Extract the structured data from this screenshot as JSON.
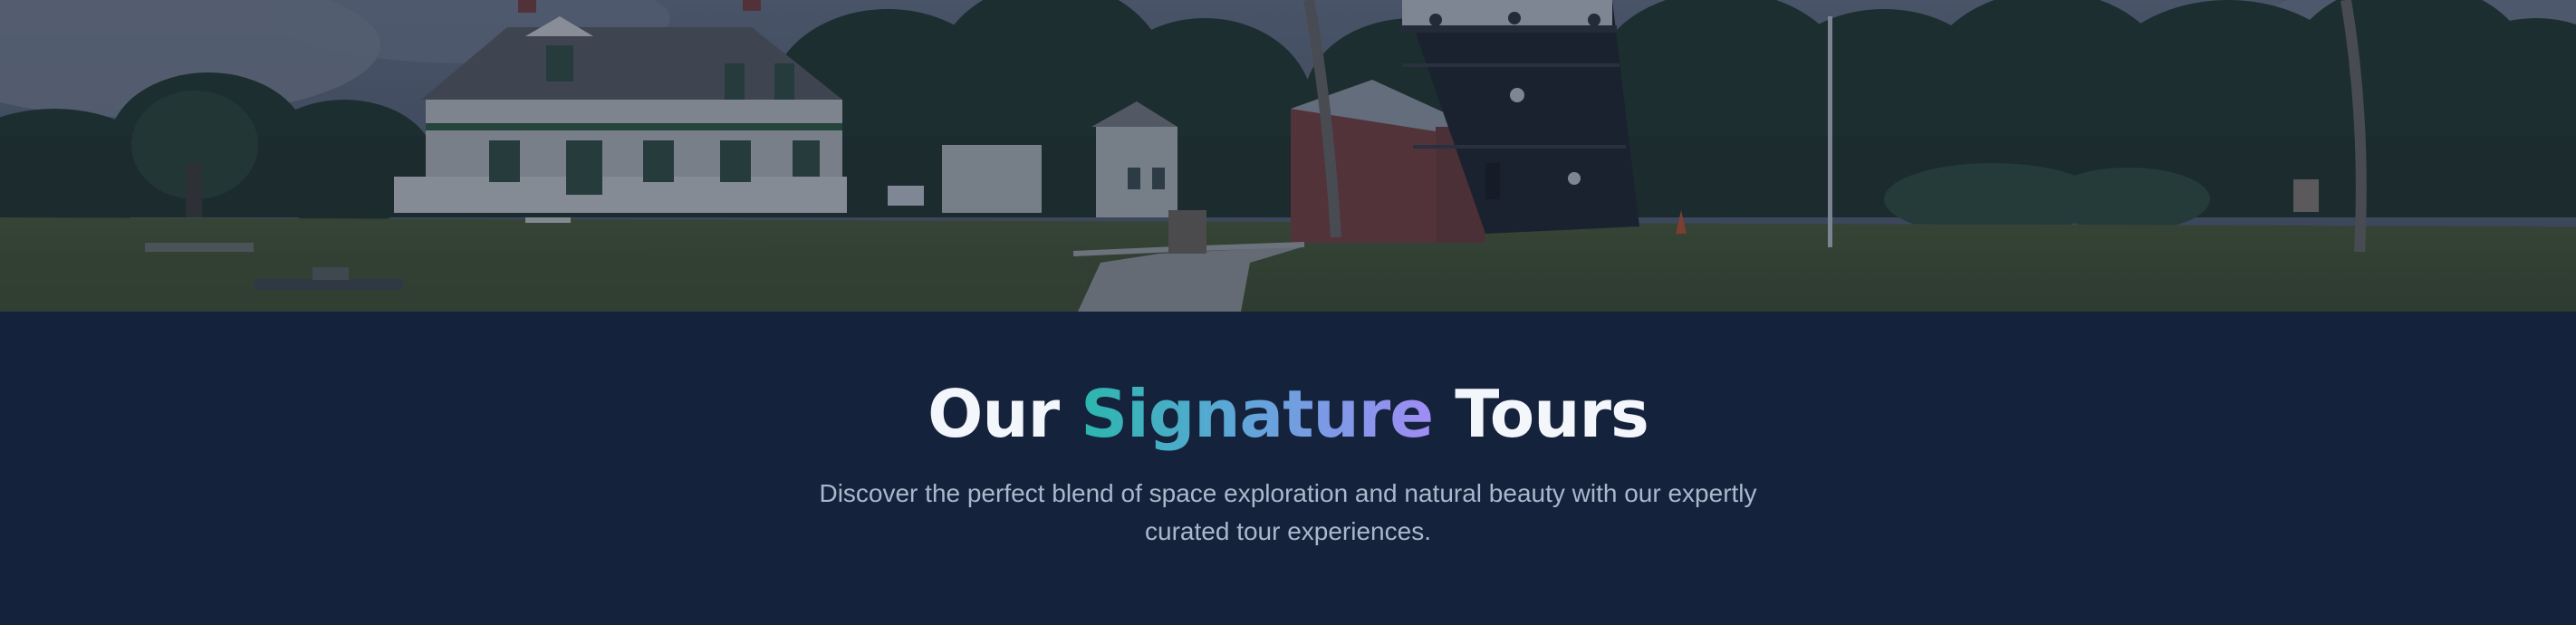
{
  "hero": {
    "icon": "lighthouse-landscape-photo"
  },
  "tours_section": {
    "title_before": "Our ",
    "title_accent": "Signature",
    "title_after": " Tours",
    "subtitle": "Discover the perfect blend of space exploration and natural beauty with our expertly curated tour experiences."
  },
  "colors": {
    "background": "#14223b",
    "title": "#f3f6fb",
    "accent_start": "#2bb7ad",
    "accent_end": "#a08cf5",
    "subtitle": "#aab8cc"
  }
}
